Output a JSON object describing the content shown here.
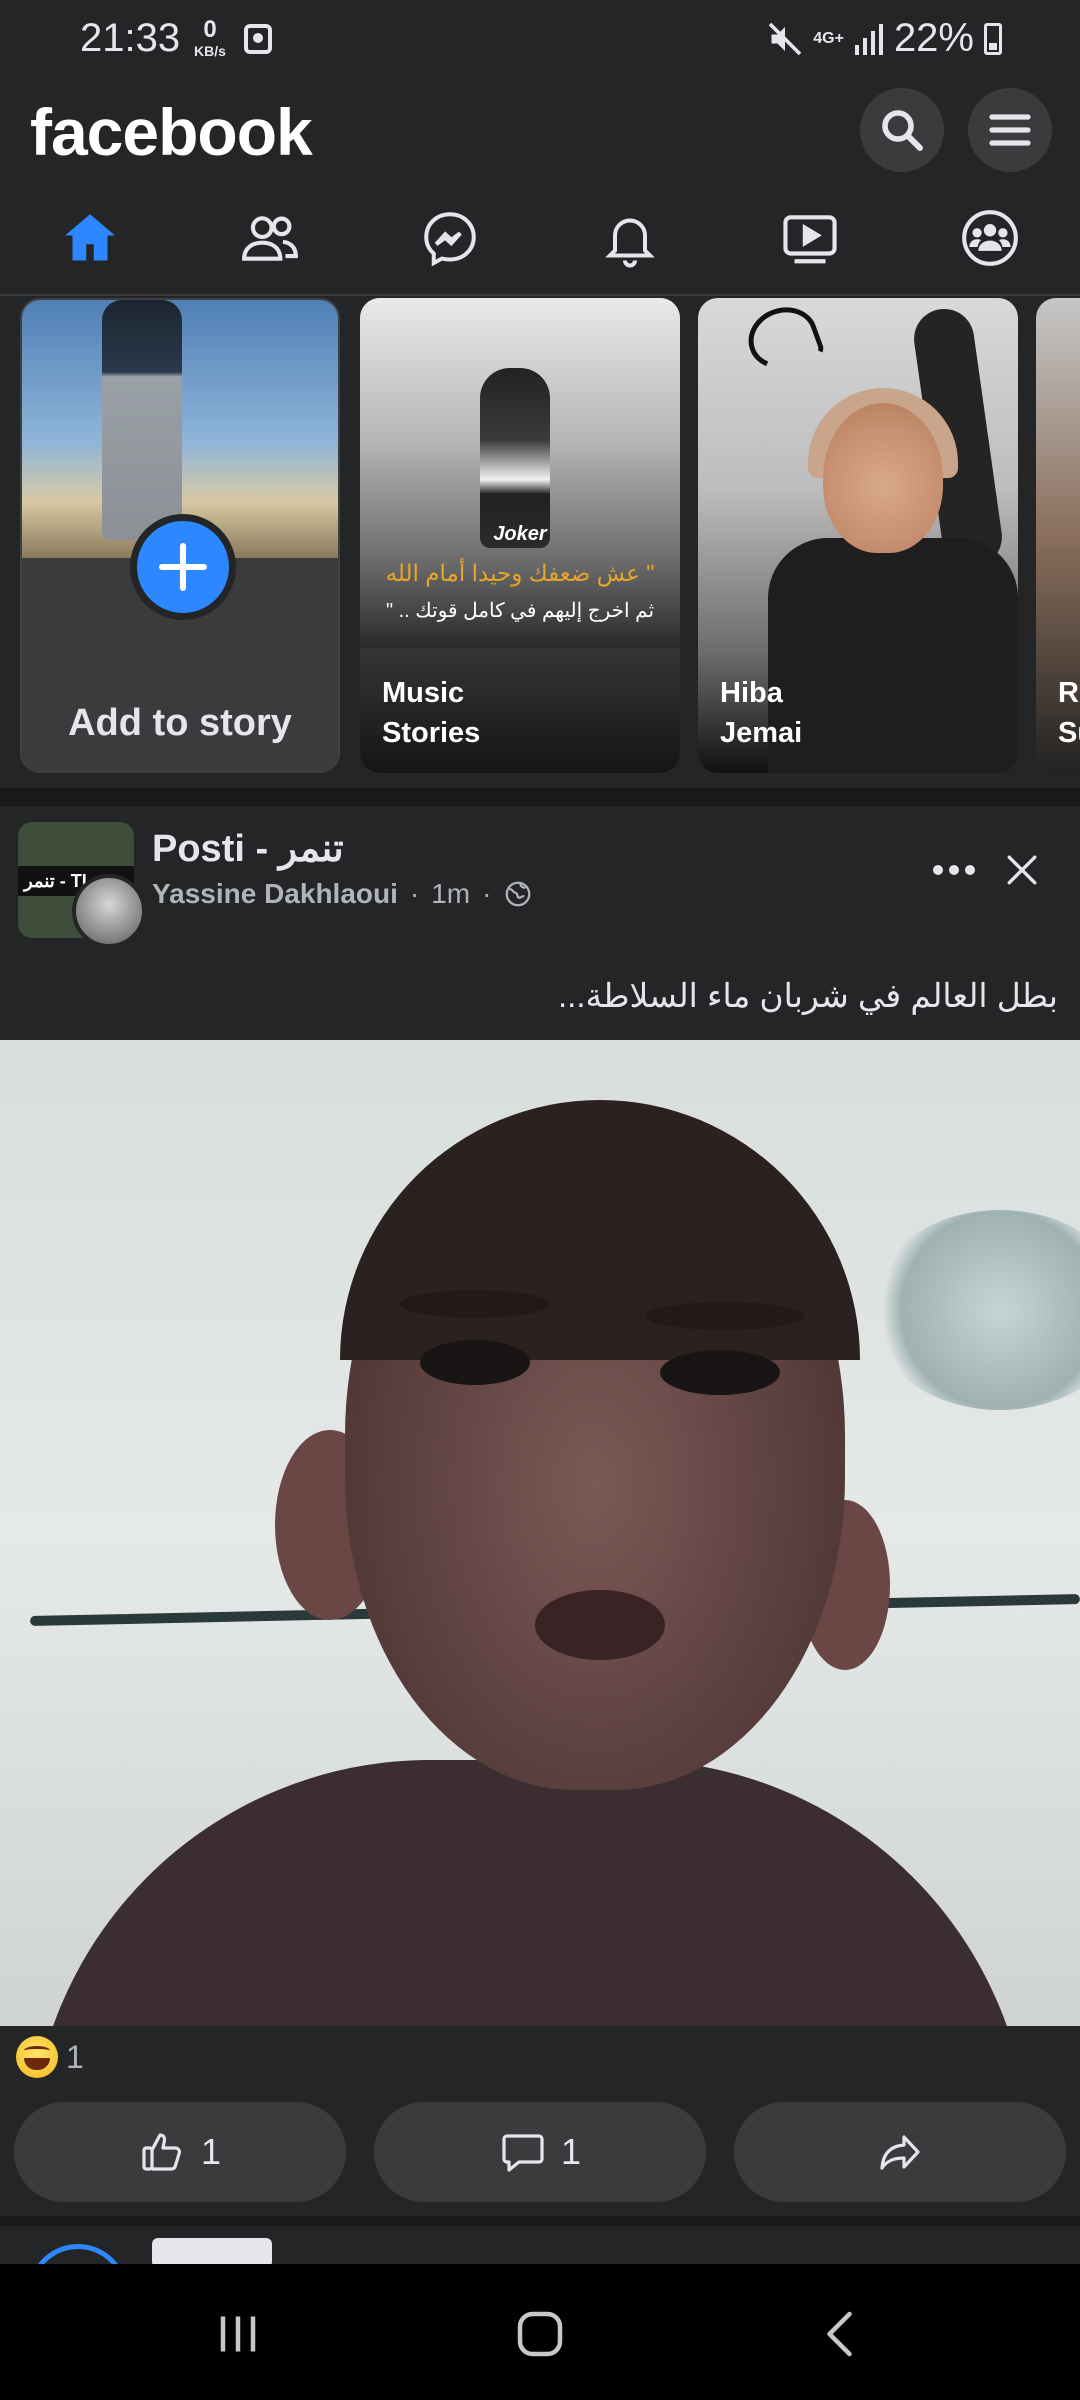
{
  "status_bar": {
    "time": "21:33",
    "speed_value": "0",
    "speed_unit": "KB/s",
    "network": "4G+",
    "battery": "22%"
  },
  "header": {
    "logo": "facebook",
    "icons": [
      "search-icon",
      "menu-icon"
    ]
  },
  "tabs": [
    {
      "name": "home",
      "icon": "home-icon",
      "active": true
    },
    {
      "name": "friends",
      "icon": "friends-icon",
      "active": false
    },
    {
      "name": "messenger",
      "icon": "messenger-icon",
      "active": false
    },
    {
      "name": "notifications",
      "icon": "bell-icon",
      "active": false
    },
    {
      "name": "watch",
      "icon": "video-icon",
      "active": false
    },
    {
      "name": "groups",
      "icon": "groups-icon",
      "active": false
    }
  ],
  "stories": {
    "add_label": "Add to story",
    "items": [
      {
        "name_line1": "Music",
        "name_line2": "Stories",
        "overlay_title": "Joker",
        "overlay_line1": "\" عش ضعفك وحيدا أمام الله",
        "overlay_line2": "ثم اخرج إليهم في كامل قوتك .. \""
      },
      {
        "name_line1": "Hiba",
        "name_line2": "Jemai"
      },
      {
        "name_line1": "Re",
        "name_line2": "Su"
      }
    ]
  },
  "post": {
    "page_name": "Posti - تنمر",
    "avatar_text": "تنمر - TI",
    "author": "Yassine  Dakhlaoui",
    "time": "1m",
    "privacy_icon": "globe-icon",
    "text": "بطل العالم في شربان ماء السلاطة...",
    "reaction_icon": "laugh-icon",
    "reaction_count": "1",
    "like_count": "1",
    "comment_count": "1"
  },
  "colors": {
    "background": "#242526",
    "accent": "#2d88ff",
    "text": "#e4e6eb",
    "secondary_text": "#b0b3b8",
    "button_bg": "#3a3b3c"
  }
}
